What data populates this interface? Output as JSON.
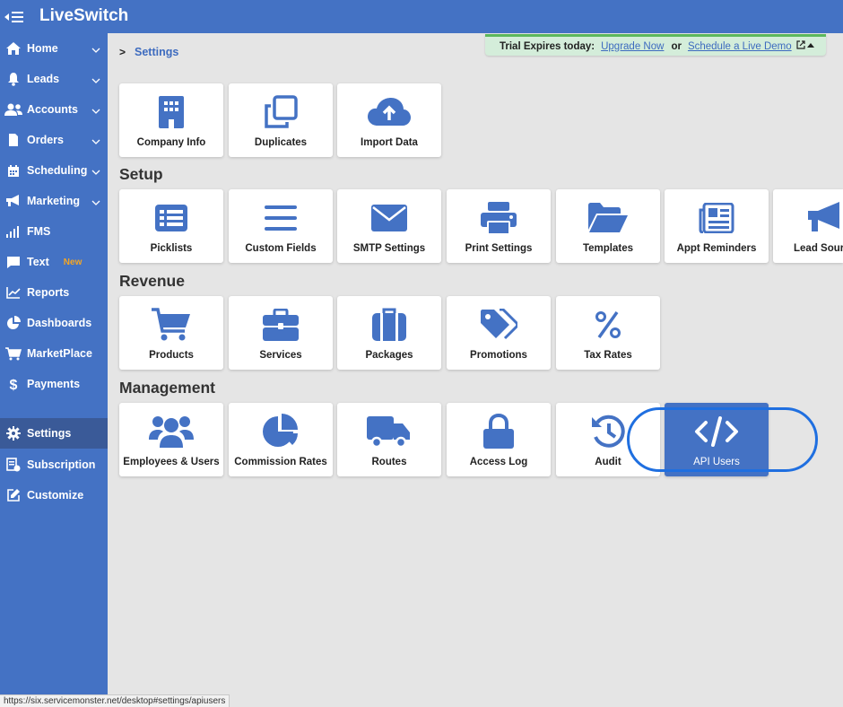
{
  "app": {
    "brand": "LiveSwitch"
  },
  "sidebar": {
    "items": [
      {
        "label": "Home",
        "icon": "home-icon",
        "chevron": true
      },
      {
        "label": "Leads",
        "icon": "bell-icon",
        "chevron": true
      },
      {
        "label": "Accounts",
        "icon": "users-icon",
        "chevron": true
      },
      {
        "label": "Orders",
        "icon": "document-icon",
        "chevron": true
      },
      {
        "label": "Scheduling",
        "icon": "calendar-icon",
        "chevron": true
      },
      {
        "label": "Marketing",
        "icon": "megaphone-icon",
        "chevron": true
      },
      {
        "label": "FMS",
        "icon": "signal-bars-icon",
        "chevron": false
      },
      {
        "label": "Text",
        "icon": "chat-icon",
        "badge": "New",
        "chevron": false
      },
      {
        "label": "Reports",
        "icon": "line-chart-icon",
        "chevron": false
      },
      {
        "label": "Dashboards",
        "icon": "pie-chart-icon",
        "chevron": false
      },
      {
        "label": "MarketPlace",
        "icon": "cart-icon",
        "chevron": false
      },
      {
        "label": "Payments",
        "icon": "dollar-icon",
        "chevron": false
      },
      {
        "label": "Settings",
        "icon": "gear-icon",
        "chevron": false,
        "active": true
      },
      {
        "label": "Subscription",
        "icon": "receipt-icon",
        "chevron": false
      },
      {
        "label": "Customize",
        "icon": "edit-icon",
        "chevron": false
      }
    ]
  },
  "breadcrumb": {
    "current": "Settings"
  },
  "trial_banner": {
    "text": "Trial Expires today:",
    "upgrade_link": "Upgrade Now",
    "or": "or",
    "demo_link": "Schedule a Live Demo"
  },
  "sections": {
    "general": {
      "cards": [
        "Company Info",
        "Duplicates",
        "Import Data"
      ]
    },
    "setup": {
      "title": "Setup",
      "cards": [
        "Picklists",
        "Custom Fields",
        "SMTP Settings",
        "Print Settings",
        "Templates",
        "Appt Reminders",
        "Lead Source"
      ]
    },
    "revenue": {
      "title": "Revenue",
      "cards": [
        "Products",
        "Services",
        "Packages",
        "Promotions",
        "Tax Rates"
      ]
    },
    "management": {
      "title": "Management",
      "cards": [
        "Employees & Users",
        "Commission Rates",
        "Routes",
        "Access Log",
        "Audit",
        "API Users"
      ]
    }
  },
  "status_bar": {
    "url": "https://six.servicemonster.net/desktop#settings/apiusers"
  },
  "colors": {
    "accent": "#4472c4",
    "highlight_ring": "#1f6fe0",
    "trial_bg": "#d4edda"
  }
}
